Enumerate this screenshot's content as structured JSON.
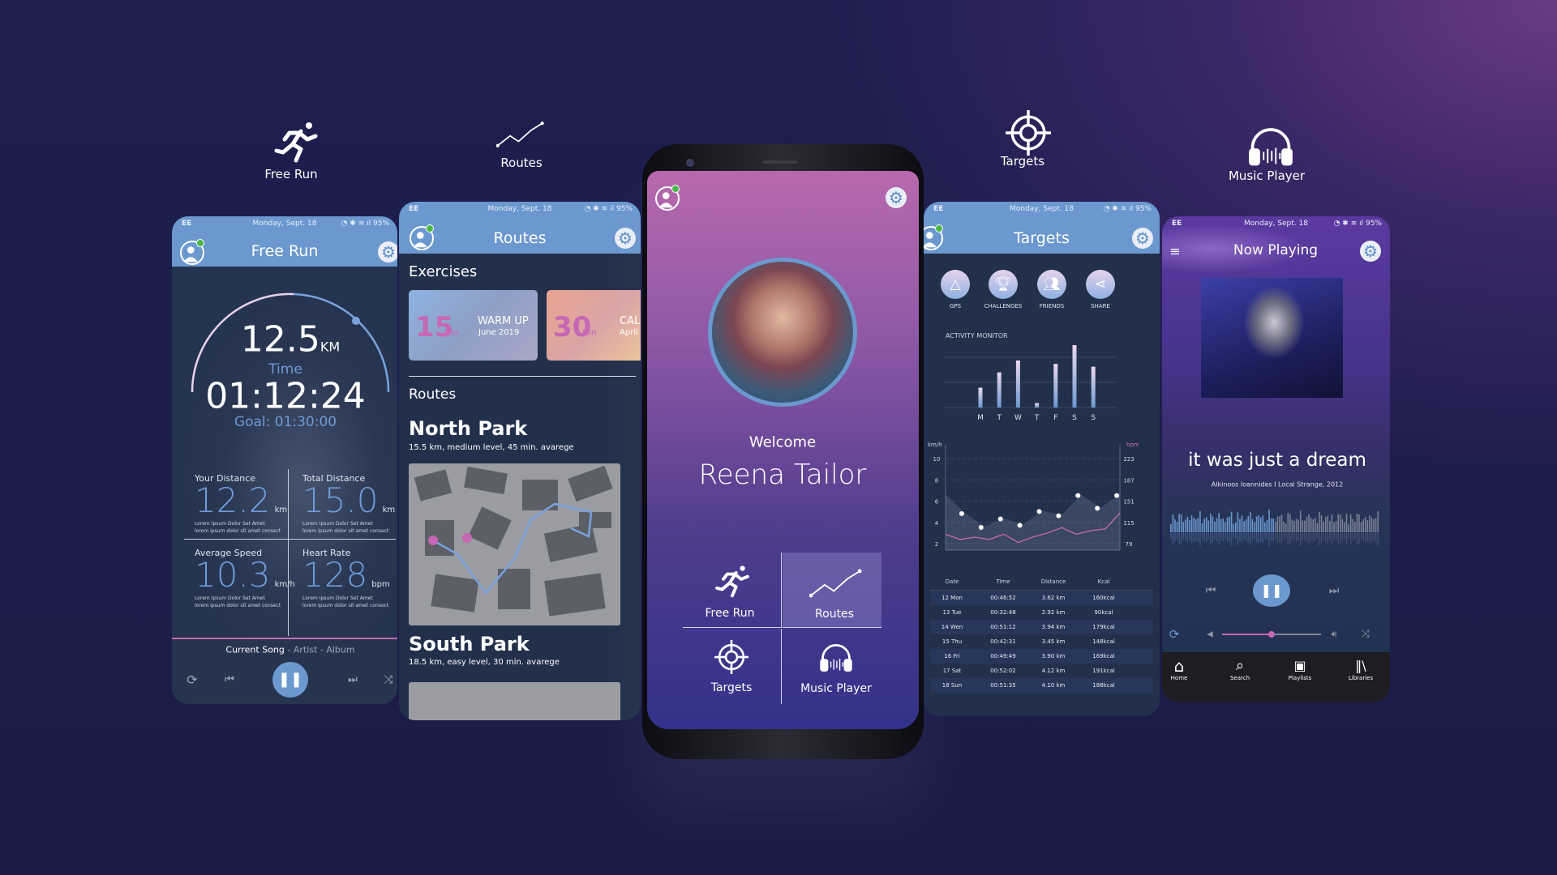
{
  "status_bar": {
    "carrier": "EE",
    "date": "Monday, Sept. 18",
    "battery": "95%"
  },
  "top_labels": [
    {
      "label": "Free Run",
      "icon": "runner-icon"
    },
    {
      "label": "Routes",
      "icon": "route-line-icon"
    },
    {
      "label": "Targets",
      "icon": "target-icon"
    },
    {
      "label": "Music Player",
      "icon": "headphones-icon"
    }
  ],
  "free_run": {
    "title": "Free Run",
    "distance": "12.5",
    "distance_unit": "KM",
    "time_label": "Time",
    "time": "01:12:24",
    "goal": "Goal: 01:30:00",
    "goal_progress": 0.8,
    "stats": [
      {
        "label": "Your Distance",
        "value": "12.2",
        "unit": "km",
        "lorem1": "Lorem Ipsum Dolor Set Amet",
        "lorem2": "lorem ipsum dolor sit amet consect"
      },
      {
        "label": "Total Distance",
        "value": "15.0",
        "unit": "km",
        "lorem1": "Lorem Ipsum Dolor Set Amet",
        "lorem2": "lorem ipsum dolor sit amet consect"
      },
      {
        "label": "Average Speed",
        "value": "10.3",
        "unit": "km/h",
        "lorem1": "Lorem Ipsum Dolor Set Amet",
        "lorem2": "lorem ipsum dolor sit amet consect"
      },
      {
        "label": "Heart Rate",
        "value": "128",
        "unit": "bpm",
        "lorem1": "Lorem Ipsum Dolor Set Amet",
        "lorem2": "lorem ipsum dolor sit amet consect"
      }
    ],
    "song": "Current Song",
    "artist": "Artist",
    "album": "Album",
    "sep": "-"
  },
  "routes": {
    "title": "Routes",
    "exercises_heading": "Exercises",
    "exercises": [
      {
        "minutes": "15",
        "min_label": "Min",
        "name": "WARM UP",
        "date": "June 2019"
      },
      {
        "minutes": "30",
        "min_label": "Min",
        "name": "CAL",
        "date": "April"
      }
    ],
    "routes_heading": "Routes",
    "list": [
      {
        "name": "North Park",
        "desc": "15.5 km, medium level, 45 min. avarege"
      },
      {
        "name": "South Park",
        "desc": "18.5 km, easy level, 30 min. avarege"
      }
    ]
  },
  "home": {
    "welcome": "Welcome",
    "name": "Reena Tailor",
    "tiles": [
      {
        "label": "Free Run"
      },
      {
        "label": "Routes"
      },
      {
        "label": "Targets"
      },
      {
        "label": "Music Player"
      }
    ],
    "active_tile": "Routes"
  },
  "targets": {
    "title": "Targets",
    "actions": [
      {
        "label": "GPS"
      },
      {
        "label": "CHALLENGES"
      },
      {
        "label": "FRIENDS"
      },
      {
        "label": "SHARE"
      }
    ],
    "activity_label": "ACTIVITY MONITOR",
    "chart_data": [
      {
        "type": "bar",
        "title": "ACTIVITY MONITOR",
        "categories": [
          "M",
          "T",
          "W",
          "T",
          "F",
          "S",
          "S"
        ],
        "values": [
          35,
          62,
          83,
          8,
          77,
          110,
          72
        ],
        "grid": true
      },
      {
        "type": "line",
        "ylabel": "km/h",
        "y2label": "bpm",
        "yticks": [
          "10",
          "8",
          "6",
          "4",
          "2"
        ],
        "y2ticks": [
          "223",
          "187",
          "151",
          "115",
          "79"
        ],
        "ylim": [
          2,
          10
        ],
        "y2lim": [
          79,
          223
        ],
        "series": [
          {
            "axis": "km/h",
            "style": "points+area",
            "values": [
              6.6,
              4.9,
              3.6,
              4.4,
              3.8,
              5.1,
              4.7,
              6.6,
              5.4,
              6.6
            ]
          },
          {
            "axis": "bpm",
            "style": "line",
            "values": [
              95,
              86,
              90,
              86,
              95,
              81,
              90,
              97,
              106,
              95,
              101,
              104,
              131
            ]
          }
        ]
      }
    ],
    "table": {
      "headers": [
        "Date",
        "Time",
        "Distance",
        "Kcal"
      ],
      "rows": [
        [
          "12 Mon",
          "00:46:52",
          "3.62 km",
          "160kcal"
        ],
        [
          "13 Tue",
          "00:32:48",
          "2.92 km",
          "90kcal"
        ],
        [
          "14 Wen",
          "00:51:12",
          "3.94 km",
          "179kcal"
        ],
        [
          "15 Thu",
          "00:42:31",
          "3.45 km",
          "148kcal"
        ],
        [
          "16 Fri",
          "00:49:49",
          "3.90 km",
          "169kcal"
        ],
        [
          "17 Sat",
          "00:52:02",
          "4.12 km",
          "191kcal"
        ],
        [
          "18 Sun",
          "00:51:35",
          "4.10 km",
          "188kcal"
        ]
      ]
    }
  },
  "music": {
    "title": "Now Playing",
    "song": "it was just a dream",
    "meta": "Alkinoos Ioannides I Local Strange, 2012",
    "playback_progress": 0.5,
    "volume": 0.5,
    "nav": [
      {
        "label": "Home"
      },
      {
        "label": "Search"
      },
      {
        "label": "Playlists"
      },
      {
        "label": "Libraries"
      }
    ]
  },
  "colors": {
    "accent": "#6b98cf",
    "pink": "#c768b5",
    "panel": "#243350",
    "background": "#1c1d4a"
  }
}
